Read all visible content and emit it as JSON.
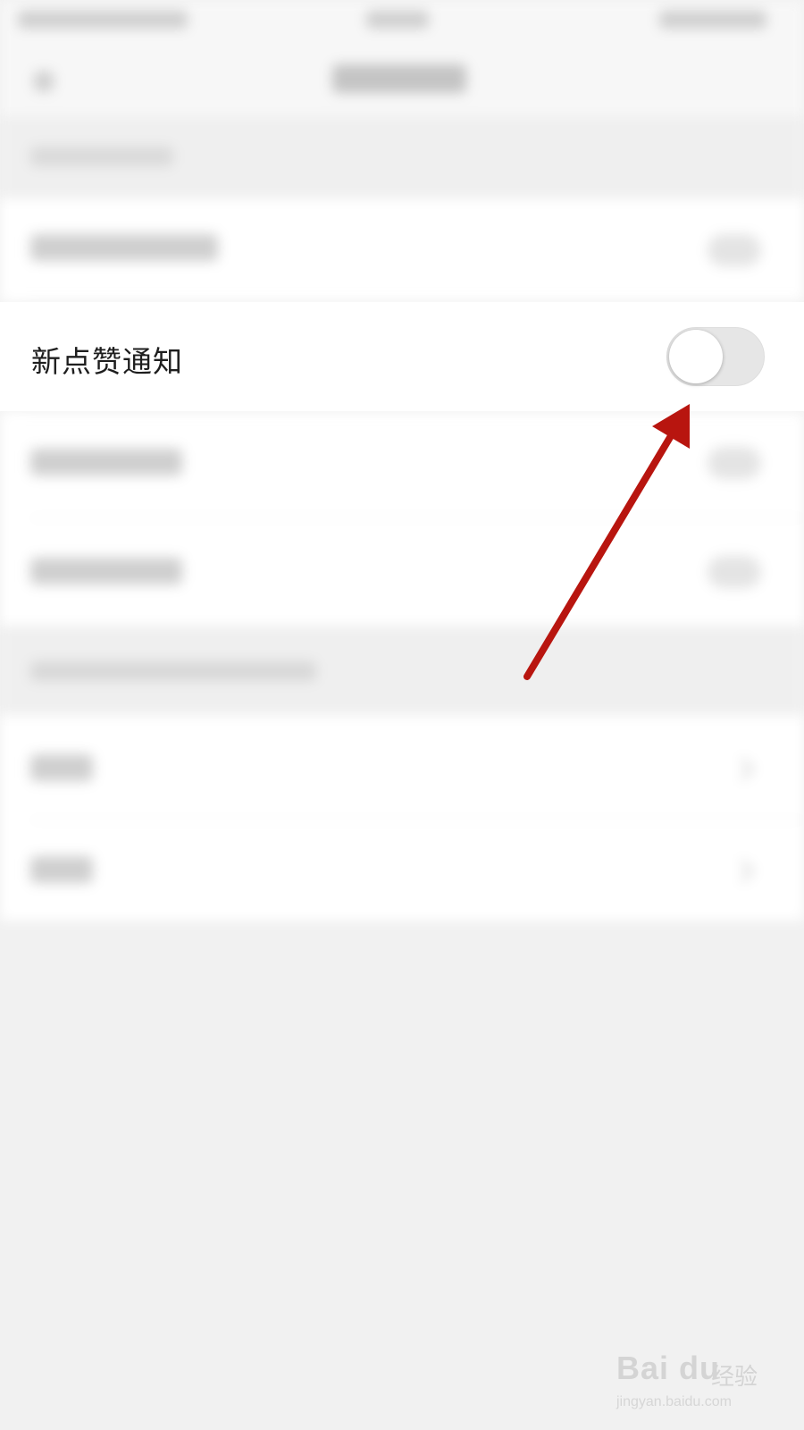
{
  "setting_row": {
    "label": "新点赞通知",
    "toggle_on": false
  },
  "annotation": {
    "arrow_color": "#b8150f"
  },
  "watermark": {
    "brand": "Bai du",
    "brand_suffix": "经验",
    "url": "jingyan.baidu.com"
  },
  "colors": {
    "background": "#f1f1f1",
    "row_background": "#ffffff",
    "toggle_off_track": "#e6e6e6"
  }
}
